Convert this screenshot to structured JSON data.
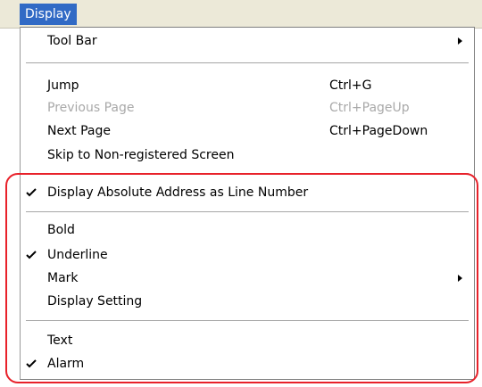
{
  "menubar": {
    "display_label": "Display"
  },
  "menu": {
    "items": [
      {
        "label": "Tool Bar"
      },
      {
        "label": "Jump",
        "shortcut": "Ctrl+G"
      },
      {
        "label": "Previous Page",
        "shortcut": "Ctrl+PageUp"
      },
      {
        "label": "Next Page",
        "shortcut": "Ctrl+PageDown"
      },
      {
        "label": "Skip to Non-registered Screen"
      },
      {
        "label": "Display Absolute Address as Line Number"
      },
      {
        "label": "Bold"
      },
      {
        "label": "Underline"
      },
      {
        "label": "Mark"
      },
      {
        "label": "Display Setting"
      },
      {
        "label": "Text"
      },
      {
        "label": "Alarm"
      }
    ]
  },
  "state": {
    "checked": [
      "Display Absolute Address as Line Number",
      "Underline",
      "Alarm"
    ],
    "disabled": [
      "Previous Page"
    ],
    "has_submenu": [
      "Tool Bar",
      "Mark"
    ]
  },
  "colors": {
    "highlight_accent": "#e8212a",
    "menubar_selected": "#316ac5"
  }
}
